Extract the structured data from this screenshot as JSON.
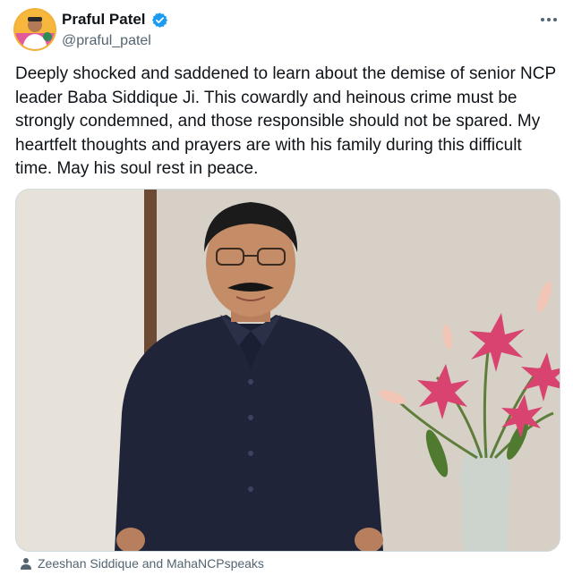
{
  "author": {
    "display_name": "Praful Patel",
    "handle": "@praful_patel",
    "verified": true
  },
  "tweet": {
    "text": "Deeply shocked and saddened to learn about the demise of senior NCP leader Baba Siddique Ji. This cowardly and heinous crime must be strongly condemned, and those responsible should not be spared. My heartfelt thoughts and prayers are with his family during this difficult time. May his soul rest in peace."
  },
  "media": {
    "tagged_text": "Zeeshan Siddique and MahaNCPspeaks"
  },
  "icons": {
    "verified": "verified-badge-icon",
    "more": "more-options-icon",
    "tag": "person-tag-icon"
  },
  "colors": {
    "verified_blue": "#1d9bf0",
    "secondary_text": "#536471",
    "shirt": "#1f2438",
    "flowers": "#d8436f"
  }
}
